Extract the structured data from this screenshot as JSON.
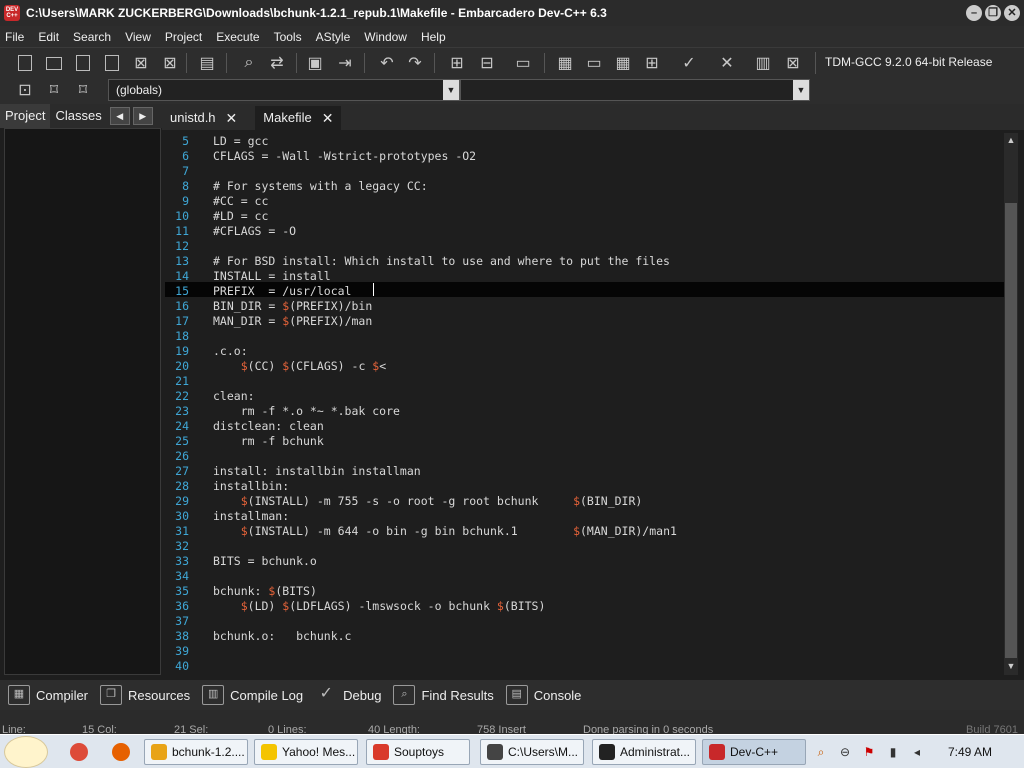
{
  "window": {
    "icon_text": "DEV C++",
    "title": "C:\\Users\\MARK ZUCKERBERG\\Downloads\\bchunk-1.2.1_repub.1\\Makefile - Embarcadero Dev-C++ 6.3",
    "minimize": "–",
    "maximize": "❐",
    "close": "✕"
  },
  "menu": [
    "File",
    "Edit",
    "Search",
    "View",
    "Project",
    "Execute",
    "Tools",
    "AStyle",
    "Window",
    "Help"
  ],
  "toolbar": {
    "compiler": "TDM-GCC 9.2.0 64-bit Release",
    "scope_value": "(globals)",
    "dropdown_arrow": "▼"
  },
  "left_tabs": {
    "project": "Project",
    "classes": "Classes",
    "prev": "◀",
    "next": "▶"
  },
  "editor_tabs": [
    {
      "label": "unistd.h",
      "close": "✕"
    },
    {
      "label": "Makefile",
      "close": "✕"
    }
  ],
  "code": [
    {
      "n": "5",
      "text": "LD = gcc"
    },
    {
      "n": "6",
      "text": "CFLAGS = -Wall -Wstrict-prototypes -O2"
    },
    {
      "n": "7",
      "text": ""
    },
    {
      "n": "8",
      "text": "# For systems with a legacy CC:"
    },
    {
      "n": "9",
      "text": "#CC = cc"
    },
    {
      "n": "10",
      "text": "#LD = cc"
    },
    {
      "n": "11",
      "text": "#CFLAGS = -O"
    },
    {
      "n": "12",
      "text": ""
    },
    {
      "n": "13",
      "text": "# For BSD install: Which install to use and where to put the files"
    },
    {
      "n": "14",
      "text": "INSTALL = install"
    },
    {
      "n": "15",
      "text": "PREFIX  = /usr/local"
    },
    {
      "n": "16",
      "text": "BIN_DIR = $(PREFIX)/bin"
    },
    {
      "n": "17",
      "text": "MAN_DIR = $(PREFIX)/man"
    },
    {
      "n": "18",
      "text": ""
    },
    {
      "n": "19",
      "text": ".c.o:"
    },
    {
      "n": "20",
      "text": "    $(CC) $(CFLAGS) -c $<"
    },
    {
      "n": "21",
      "text": ""
    },
    {
      "n": "22",
      "text": "clean:"
    },
    {
      "n": "23",
      "text": "    rm -f *.o *~ *.bak core"
    },
    {
      "n": "24",
      "text": "distclean: clean"
    },
    {
      "n": "25",
      "text": "    rm -f bchunk"
    },
    {
      "n": "26",
      "text": ""
    },
    {
      "n": "27",
      "text": "install: installbin installman"
    },
    {
      "n": "28",
      "text": "installbin:"
    },
    {
      "n": "29",
      "text": "    $(INSTALL) -m 755 -s -o root -g root bchunk     $(BIN_DIR)"
    },
    {
      "n": "30",
      "text": "installman:"
    },
    {
      "n": "31",
      "text": "    $(INSTALL) -m 644 -o bin -g bin bchunk.1        $(MAN_DIR)/man1"
    },
    {
      "n": "32",
      "text": ""
    },
    {
      "n": "33",
      "text": "BITS = bchunk.o"
    },
    {
      "n": "34",
      "text": ""
    },
    {
      "n": "35",
      "text": "bchunk: $(BITS)"
    },
    {
      "n": "36",
      "text": "    $(LD) $(LDFLAGS) -lmswsock -o bchunk $(BITS)"
    },
    {
      "n": "37",
      "text": ""
    },
    {
      "n": "38",
      "text": "bchunk.o:   bchunk.c"
    },
    {
      "n": "39",
      "text": ""
    },
    {
      "n": "40",
      "text": ""
    }
  ],
  "bottom_tabs": [
    {
      "label": "Compiler",
      "icon": "compiler-icon"
    },
    {
      "label": "Resources",
      "icon": "resources-icon"
    },
    {
      "label": "Compile Log",
      "icon": "compile-log-icon"
    },
    {
      "label": "Debug",
      "icon": "debug-icon"
    },
    {
      "label": "Find Results",
      "icon": "find-results-icon"
    },
    {
      "label": "Console",
      "icon": "console-icon"
    }
  ],
  "status": {
    "line": "Line:",
    "line_val": "15 Col:",
    "col_val": "21 Sel:",
    "sel_val": "0 Lines:",
    "lines_val": "40 Length:",
    "length_val": "758 Insert",
    "message": "Done parsing in 0 seconds"
  },
  "taskbar": {
    "buttons": [
      {
        "label": "bchunk-1.2....",
        "icon_color": "#e8a317"
      },
      {
        "label": "Yahoo! Mes...",
        "icon_color": "#f4c400"
      },
      {
        "label": "Souptoys",
        "icon_color": "#d93a2b"
      },
      {
        "label": "C:\\Users\\M...",
        "icon_color": "#444444"
      },
      {
        "label": "Administrat...",
        "icon_color": "#222222"
      },
      {
        "label": "Dev-C++",
        "icon_color": "#c8282a"
      }
    ],
    "clock": "7:49 AM",
    "build_text": "Build 7601"
  },
  "colors": {
    "line_number": "#3fa7d6",
    "dollar": "#e8643a",
    "accent_red": "#c8282a"
  }
}
